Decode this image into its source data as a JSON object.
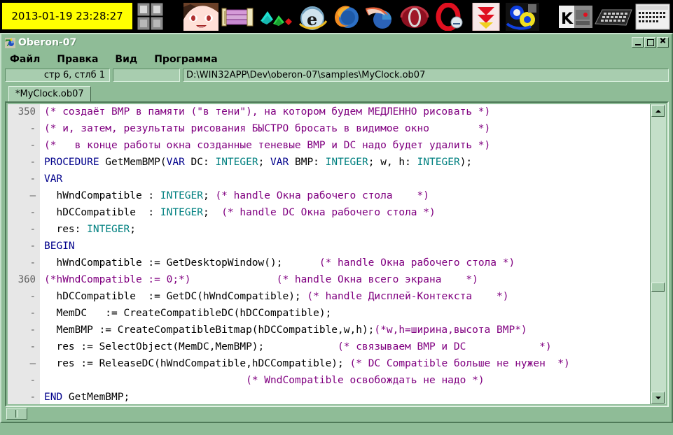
{
  "taskbar": {
    "clock": "2013-01-19 23:28:27",
    "icons": [
      {
        "name": "game-tiles-icon",
        "label": "game"
      },
      {
        "name": "anime-face-icon",
        "label": "anime"
      },
      {
        "name": "winrar-books-icon",
        "label": "winrar"
      },
      {
        "name": "gimp-brushes-icon",
        "label": "gimp"
      },
      {
        "name": "internet-explorer-icon",
        "label": "ie"
      },
      {
        "name": "firefox-icon",
        "label": "firefox"
      },
      {
        "name": "seamonkey-icon",
        "label": "seamonkey"
      },
      {
        "name": "opera-icon",
        "label": "opera"
      },
      {
        "name": "opera-red-icon",
        "label": "opera2"
      },
      {
        "name": "download-master-icon",
        "label": "dm"
      },
      {
        "name": "fasm-icon",
        "label": "fasm"
      },
      {
        "name": "k-editor-icon",
        "label": "k"
      },
      {
        "name": "keyboard-icon",
        "label": "keyboard"
      },
      {
        "name": "terminal-icon",
        "label": "terminal"
      }
    ]
  },
  "window": {
    "title": "Oberon-07",
    "icon": "oberon-07-icon",
    "controls": {
      "minimize": "_",
      "maximize": "□",
      "close": "×"
    }
  },
  "menu": {
    "items": [
      {
        "name": "menu-file",
        "label": "Файл"
      },
      {
        "name": "menu-edit",
        "label": "Правка"
      },
      {
        "name": "menu-view",
        "label": "Вид"
      },
      {
        "name": "menu-program",
        "label": "Программа"
      }
    ]
  },
  "status": {
    "position": "стр 6, стлб 1",
    "middle": "",
    "path": "D:\\WIN32APP\\Dev\\oberon-07\\samples\\MyClock.ob07"
  },
  "tabs": [
    {
      "name": "tab-myclock",
      "label": "*MyClock.ob07",
      "active": true
    }
  ],
  "editor": {
    "first_line_number": 350,
    "gutter_marks": [
      "350",
      "-",
      "-",
      "-",
      "-",
      "—",
      "-",
      "-",
      "-",
      "-",
      "360",
      "-",
      "-",
      "-",
      "-",
      "—",
      "-",
      "-"
    ],
    "lines": [
      {
        "n": "350",
        "tokens": [
          {
            "t": "(* создаёт BMP в памяти (\"в тени\"), на котором будем МЕДЛЕННО рисовать *)",
            "c": "cm"
          }
        ]
      },
      {
        "n": "-",
        "tokens": [
          {
            "t": "(* и, затем, результаты рисования БЫСТРО бросать в видимое окно        *)",
            "c": "cm"
          }
        ]
      },
      {
        "n": "-",
        "tokens": [
          {
            "t": "(*   в конце работы окна созданные теневые BMP и DC надо будет удалить *)",
            "c": "cm"
          }
        ]
      },
      {
        "n": "-",
        "tokens": [
          {
            "t": "PROCEDURE",
            "c": "kw"
          },
          {
            "t": " GetMemBMP(",
            "c": ""
          },
          {
            "t": "VAR",
            "c": "kw"
          },
          {
            "t": " DC: ",
            "c": ""
          },
          {
            "t": "INTEGER",
            "c": "ty"
          },
          {
            "t": "; ",
            "c": ""
          },
          {
            "t": "VAR",
            "c": "kw"
          },
          {
            "t": " BMP: ",
            "c": ""
          },
          {
            "t": "INTEGER",
            "c": "ty"
          },
          {
            "t": "; w, h: ",
            "c": ""
          },
          {
            "t": "INTEGER",
            "c": "ty"
          },
          {
            "t": ");",
            "c": ""
          }
        ]
      },
      {
        "n": "-",
        "tokens": [
          {
            "t": "VAR",
            "c": "kw"
          }
        ]
      },
      {
        "n": "—",
        "tokens": [
          {
            "t": "  hWndCompatible : ",
            "c": ""
          },
          {
            "t": "INTEGER",
            "c": "ty"
          },
          {
            "t": "; ",
            "c": ""
          },
          {
            "t": "(* handle Окна рабочего стола    *)",
            "c": "cm"
          }
        ]
      },
      {
        "n": "-",
        "tokens": [
          {
            "t": "  hDCCompatible  : ",
            "c": ""
          },
          {
            "t": "INTEGER",
            "c": "ty"
          },
          {
            "t": ";  ",
            "c": ""
          },
          {
            "t": "(* handle DC Окна рабочего стола *)",
            "c": "cm"
          }
        ]
      },
      {
        "n": "-",
        "tokens": [
          {
            "t": "  res: ",
            "c": ""
          },
          {
            "t": "INTEGER",
            "c": "ty"
          },
          {
            "t": ";",
            "c": ""
          }
        ]
      },
      {
        "n": "-",
        "tokens": [
          {
            "t": "BEGIN",
            "c": "kw"
          }
        ]
      },
      {
        "n": "-",
        "tokens": [
          {
            "t": "  hWndCompatible := GetDesktopWindow();      ",
            "c": ""
          },
          {
            "t": "(* handle Окна рабочего стола *)",
            "c": "cm"
          }
        ]
      },
      {
        "n": "360",
        "tokens": [
          {
            "t": "(*hWndCompatible := 0;*)",
            "c": "cm"
          },
          {
            "t": "              ",
            "c": ""
          },
          {
            "t": "(* handle Окна всего экрана    *)",
            "c": "cm"
          }
        ]
      },
      {
        "n": "-",
        "tokens": [
          {
            "t": "  hDCCompatible  := GetDC(hWndCompatible); ",
            "c": ""
          },
          {
            "t": "(* handle Дисплей-Контекста    *)",
            "c": "cm"
          }
        ]
      },
      {
        "n": "-",
        "tokens": [
          {
            "t": "  MemDC   := CreateCompatibleDC(hDCCompatible);",
            "c": ""
          }
        ]
      },
      {
        "n": "-",
        "tokens": [
          {
            "t": "  MemBMP := CreateCompatibleBitmap(hDCCompatible,w,h);",
            "c": ""
          },
          {
            "t": "(*w,h=ширина,высота BMP*)",
            "c": "cm"
          }
        ]
      },
      {
        "n": "-",
        "tokens": [
          {
            "t": "  res := SelectObject(MemDC,MemBMP);            ",
            "c": ""
          },
          {
            "t": "(* связываем BMP и DC            *)",
            "c": "cm"
          }
        ]
      },
      {
        "n": "—",
        "tokens": [
          {
            "t": "  res := ReleaseDC(hWndCompatible,hDCCompatible); ",
            "c": ""
          },
          {
            "t": "(* DC Compatible больше не нужен  *)",
            "c": "cm"
          }
        ]
      },
      {
        "n": "-",
        "tokens": [
          {
            "t": "                                 ",
            "c": ""
          },
          {
            "t": "(* WndCompatible освобождать не надо *)",
            "c": "cm"
          }
        ]
      },
      {
        "n": "-",
        "tokens": [
          {
            "t": "END",
            "c": "kw"
          },
          {
            "t": " GetMemBMP;",
            "c": ""
          }
        ]
      }
    ]
  },
  "colors": {
    "window_bg": "#8fbc97",
    "title_text": "#ffffff",
    "clock_bg": "#ffff00",
    "keyword": "#00008b",
    "type": "#008080",
    "comment": "#800080",
    "gutter_bg": "#e7e7e7",
    "editor_bg": "#ffffff"
  }
}
